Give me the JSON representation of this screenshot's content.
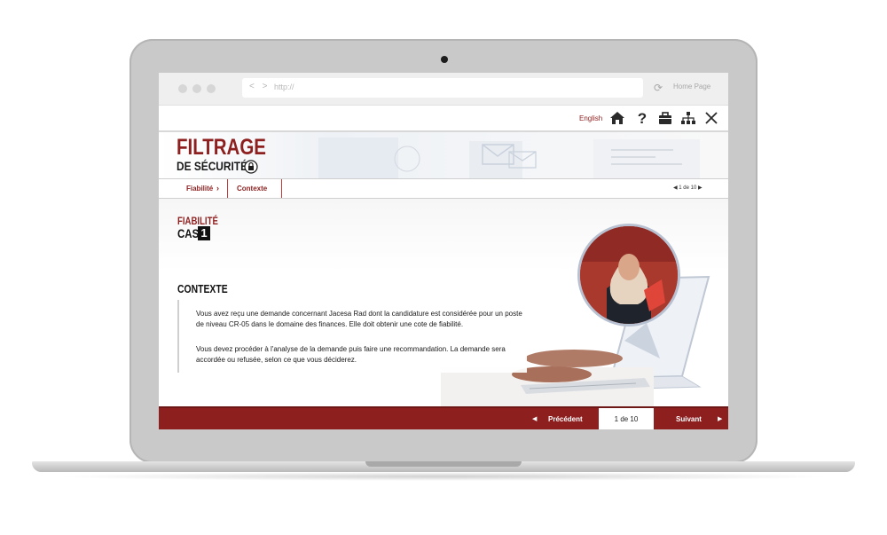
{
  "browser": {
    "url": "http://",
    "nav_arrows": "< >",
    "home_link": "Home Page"
  },
  "toolbar": {
    "language": "English",
    "icons": [
      "home-icon",
      "help-icon",
      "toolbox-icon",
      "sitemap-icon",
      "close-icon"
    ]
  },
  "header": {
    "title_line1": "FILTRAGE",
    "title_line2": "DE SÉCURITÉ"
  },
  "navbar": {
    "breadcrumb_1": "Fiabilité",
    "breadcrumb_2": "Contexte",
    "pager_text": "1 de 10"
  },
  "content": {
    "section": "FIABILITÉ",
    "case_label": "CAS",
    "case_number": "1",
    "heading": "CONTEXTE",
    "paragraph_1": "Vous avez reçu une demande concernant Jacesa Rad dont la candidature est considérée pour un poste de niveau CR-05 dans le domaine des finances. Elle doit obtenir une cote de fiabilité.",
    "paragraph_2": "Vous devez procéder à l'analyse de la demande puis faire une recommandation. La demande sera accordée ou refusée, selon ce que vous déciderez."
  },
  "footer": {
    "prev_label": "Précédent",
    "page_indicator": "1 de 10",
    "next_label": "Suivant"
  },
  "colors": {
    "brand": "#8e1f1f",
    "bezel": "#c9c9c9"
  }
}
